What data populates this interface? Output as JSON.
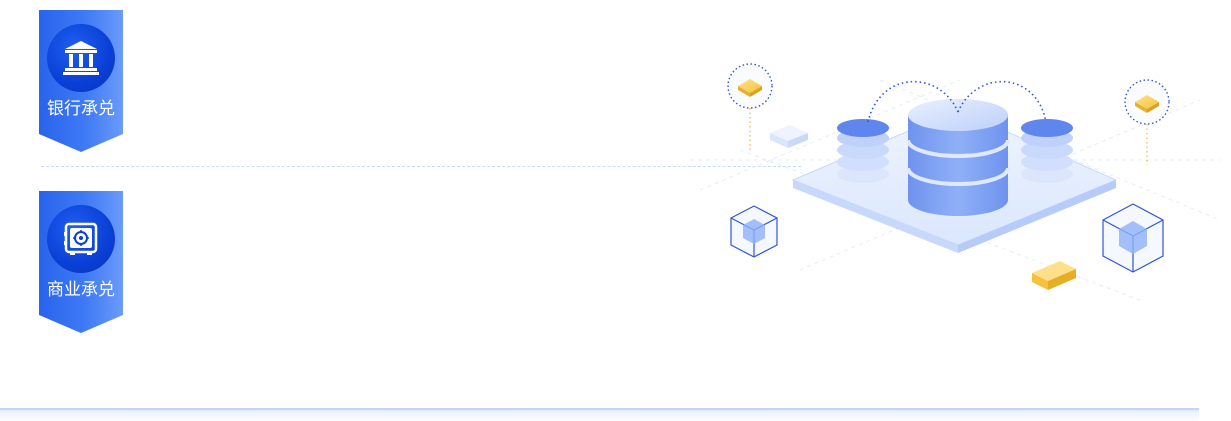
{
  "badges": [
    {
      "label": "银行承兑",
      "icon": "bank-icon"
    },
    {
      "label": "商业承兑",
      "icon": "safe-icon"
    }
  ],
  "illustration": {
    "icon": "database-illustration"
  },
  "colors": {
    "badge_primary": "#2f6cf2",
    "badge_light": "#5c8ff8",
    "icon_circle": "#0a3fd6",
    "separator": "#c9dcf6",
    "accent_yellow": "#f7c948"
  }
}
